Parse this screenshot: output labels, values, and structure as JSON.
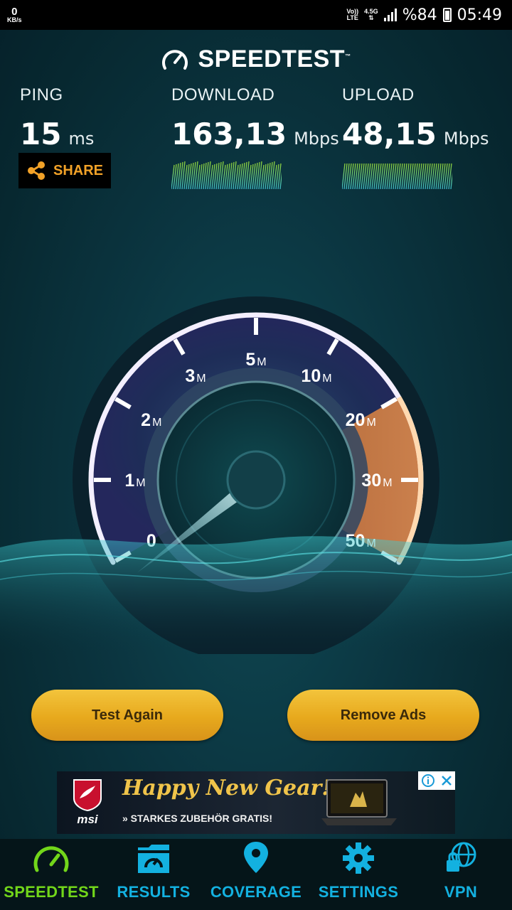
{
  "status_bar": {
    "net_speed": "0",
    "net_unit": "KB/s",
    "volte": "Vo))",
    "lte": "LTE",
    "network_type": "4.5G",
    "battery": "%84",
    "time": "05:49"
  },
  "header": {
    "logo_text": "SPEEDTEST",
    "trademark": "™"
  },
  "metrics": {
    "ping": {
      "label": "PING",
      "value": "15",
      "unit": "ms"
    },
    "download": {
      "label": "DOWNLOAD",
      "value": "163,13",
      "unit": "Mbps"
    },
    "upload": {
      "label": "UPLOAD",
      "value": "48,15",
      "unit": "Mbps"
    }
  },
  "share": {
    "label": "SHARE"
  },
  "gauge": {
    "ticks": [
      {
        "value": "0",
        "unit": ""
      },
      {
        "value": "1",
        "unit": "M"
      },
      {
        "value": "2",
        "unit": "M"
      },
      {
        "value": "3",
        "unit": "M"
      },
      {
        "value": "5",
        "unit": "M"
      },
      {
        "value": "10",
        "unit": "M"
      },
      {
        "value": "20",
        "unit": "M"
      },
      {
        "value": "30",
        "unit": "M"
      },
      {
        "value": "50",
        "unit": "M"
      }
    ],
    "needle_tick_index": 0
  },
  "buttons": {
    "test_again": "Test Again",
    "remove_ads": "Remove Ads"
  },
  "ad": {
    "brand": "msi",
    "headline": "Happy New Gear!",
    "subline": "» STARKES ZUBEHÖR GRATIS!"
  },
  "tabs": [
    {
      "label": "SPEEDTEST",
      "icon": "gauge-icon",
      "active": true
    },
    {
      "label": "RESULTS",
      "icon": "folder-gauge-icon",
      "active": false
    },
    {
      "label": "COVERAGE",
      "icon": "map-pin-icon",
      "active": false
    },
    {
      "label": "SETTINGS",
      "icon": "gear-icon",
      "active": false
    },
    {
      "label": "VPN",
      "icon": "lock-globe-icon",
      "active": false
    }
  ],
  "colors": {
    "accent_orange": "#f2a228",
    "tab_blue": "#13b1e0",
    "tab_active_green": "#72d61a",
    "button_gold": "#e7a91d"
  }
}
